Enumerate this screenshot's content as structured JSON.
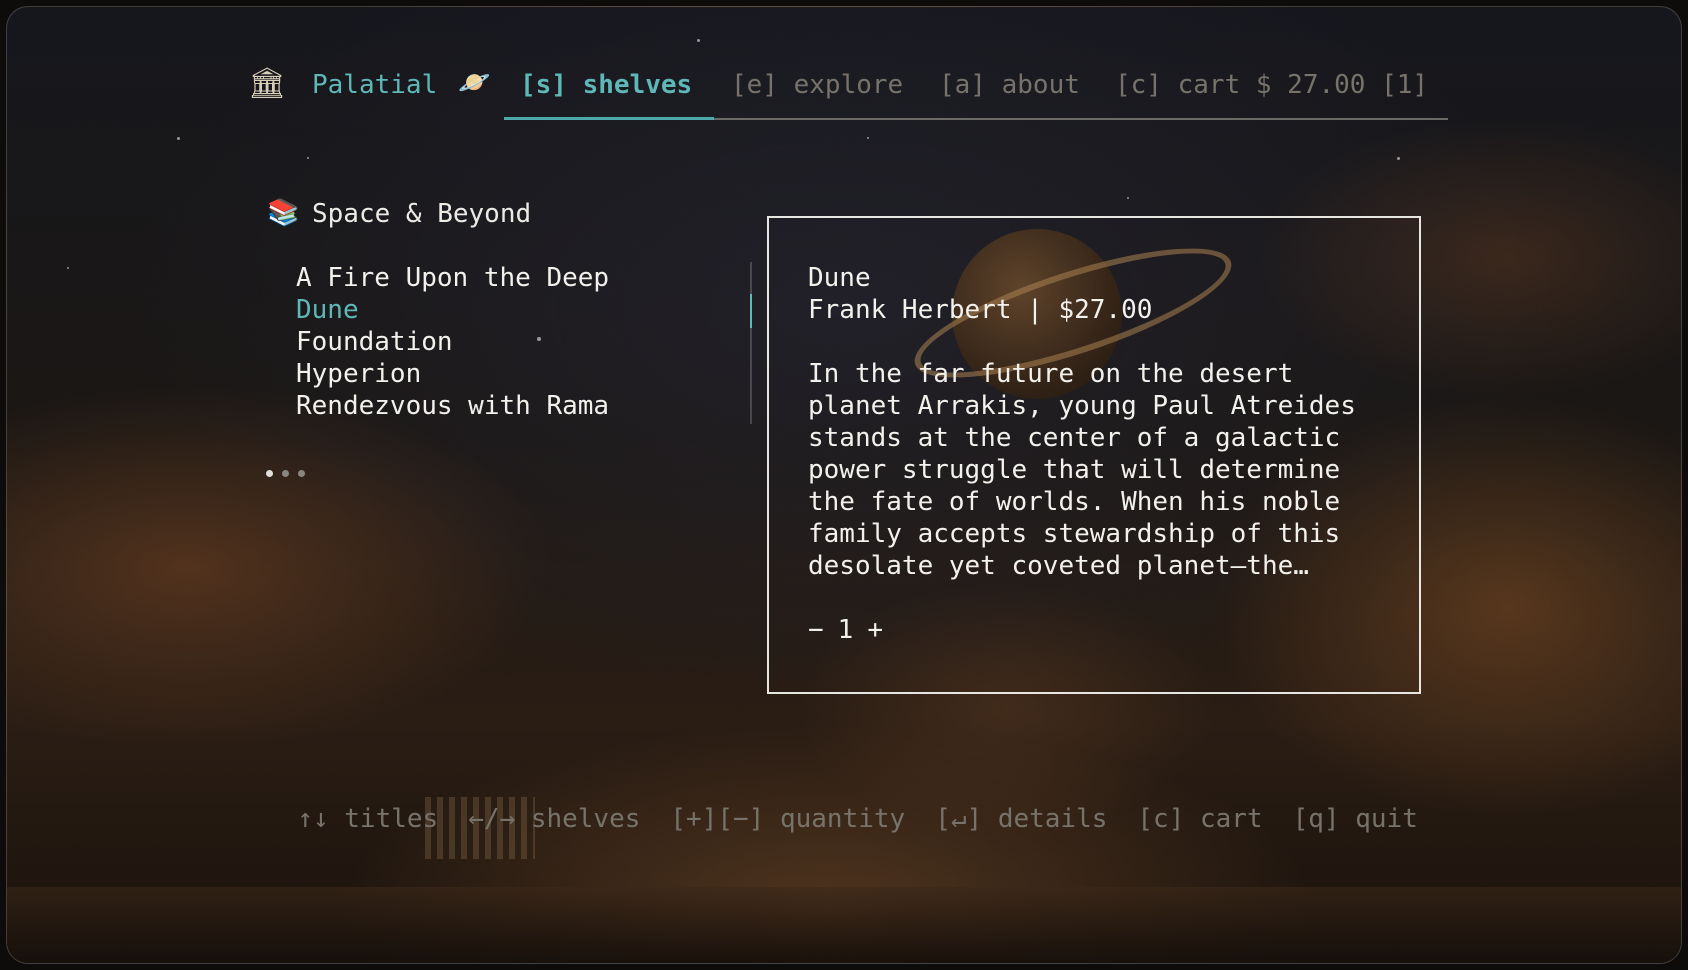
{
  "app": {
    "name": "Palatial",
    "brand_icon": "temple-icon",
    "planet_icon": "planet-icon"
  },
  "tabs": [
    {
      "label": "[s] shelves",
      "active": true
    },
    {
      "label": "[e] explore",
      "active": false
    },
    {
      "label": "[a] about",
      "active": false
    },
    {
      "label": "[c] cart $ 27.00 [1]",
      "active": false
    }
  ],
  "shelf": {
    "icon": "books-icon",
    "title": "Space & Beyond",
    "titles": [
      "A Fire Upon the Deep",
      "Dune",
      "Foundation",
      "Hyperion",
      "Rendezvous with Rama"
    ],
    "selected_index": 1,
    "page_dots": {
      "count": 3,
      "active": 0
    }
  },
  "details": {
    "title": "Dune",
    "meta": "Frank Herbert | $27.00",
    "description": "In the far future on the desert planet Arrakis, young Paul Atreides stands at the center of a galactic power struggle that will determine the fate of worlds. When his noble family accepts stewardship of this desolate yet coveted planet—the…",
    "quantity": {
      "minus": "−",
      "value": "1",
      "plus": "+"
    }
  },
  "footer": {
    "hints": [
      "↑↓ titles",
      "←/→ shelves",
      "[+][−] quantity",
      "[↵] details",
      "[c] cart",
      "[q] quit"
    ]
  },
  "colors": {
    "accent": "#5fb8b8",
    "text": "#f2f1ec",
    "muted": "#77736b"
  }
}
